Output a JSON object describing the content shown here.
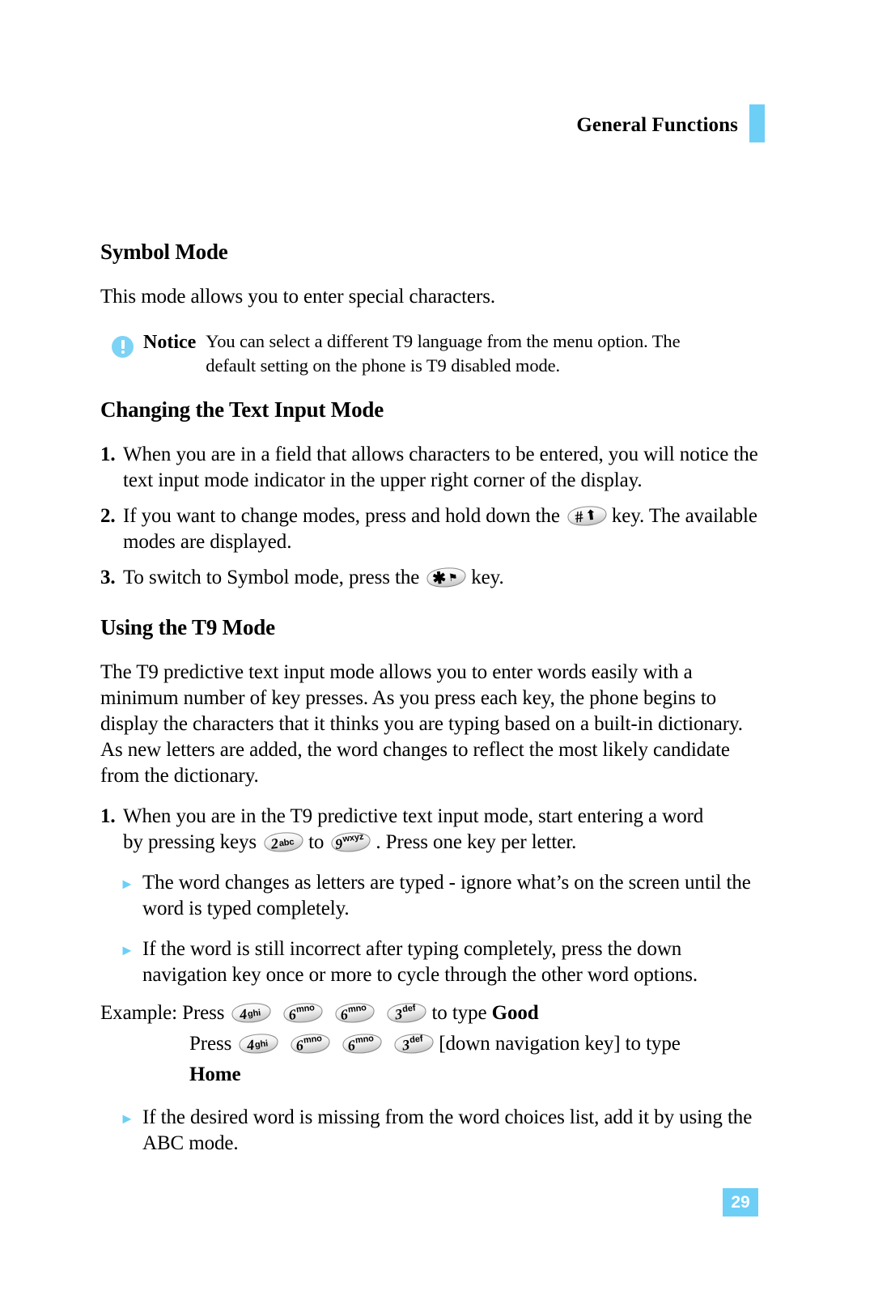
{
  "header": {
    "title": "General Functions",
    "accent_color": "#6ecff6"
  },
  "sections": {
    "symbol_mode": {
      "heading": "Symbol Mode",
      "paragraph": "This mode allows you to enter special characters."
    },
    "notice": {
      "icon": "info-circle-icon",
      "label": "Notice",
      "line1": "You can select a different T9 language from the menu option. The",
      "line2": "default setting on the phone is T9 disabled mode."
    },
    "changing_text_input": {
      "heading": "Changing the Text Input Mode",
      "steps": [
        {
          "num": "1.",
          "text": "When you are in a field that allows characters to be entered, you will notice the text input mode indicator in the upper right corner of the display."
        },
        {
          "num": "2.",
          "text_before": "If you want to change modes, press and hold down the",
          "key": "hash-shift-key",
          "text_after": "key. The available modes are displayed."
        },
        {
          "num": "3.",
          "text_before": "To switch to Symbol mode, press the",
          "key": "star-symbol-key",
          "text_after": "key."
        }
      ]
    },
    "using_t9": {
      "heading": "Using the T9 Mode",
      "paragraph": "The T9 predictive text input mode allows you to enter words easily with a minimum number of key presses. As you press each key, the phone begins to display the characters that it thinks you are typing based on a built-in dictionary. As new letters are added, the word changes to reflect the most likely candidate from the dictionary.",
      "step1": {
        "num": "1.",
        "part1": "When you are in the T9 predictive text input mode, start entering a word",
        "part2": "by pressing keys",
        "key_from": "2abc",
        "part3": "to",
        "key_to": "9wxyz",
        "part4": ". Press one key per letter."
      },
      "bullets": [
        "The word changes as letters are typed - ignore what’s on the screen until the word is typed completely.",
        "If the word is still incorrect after typing completely, press the down navigation key once or more to cycle through the other word options."
      ],
      "example": {
        "label": "Example: Press",
        "keys_line1": [
          "4ghi",
          "6mno",
          "6mno",
          "3def"
        ],
        "tail_line1": "to type",
        "word_line1": "Good",
        "label2": "Press",
        "keys_line2": [
          "4ghi",
          "6mno",
          "6mno",
          "3def"
        ],
        "tail_line2": "[down navigation key] to type",
        "word_line2": "Home"
      },
      "final_bullet": "If the desired word is missing from the word choices list, add it by using the ABC mode."
    }
  },
  "keys": {
    "hash-shift-key": {
      "symbol": "#",
      "glyph": "⬆"
    },
    "star-symbol-key": {
      "symbol": "✱",
      "glyph": "⚑"
    },
    "2abc": {
      "digit": "2",
      "letters": "abc"
    },
    "9wxyz": {
      "digit": "9",
      "letters": "wxyz"
    },
    "4ghi": {
      "digit": "4",
      "letters": "ghi"
    },
    "6mno": {
      "digit": "6",
      "letters": "mno"
    },
    "3def": {
      "digit": "3",
      "letters": "def"
    }
  },
  "footer": {
    "page_number": "29"
  }
}
